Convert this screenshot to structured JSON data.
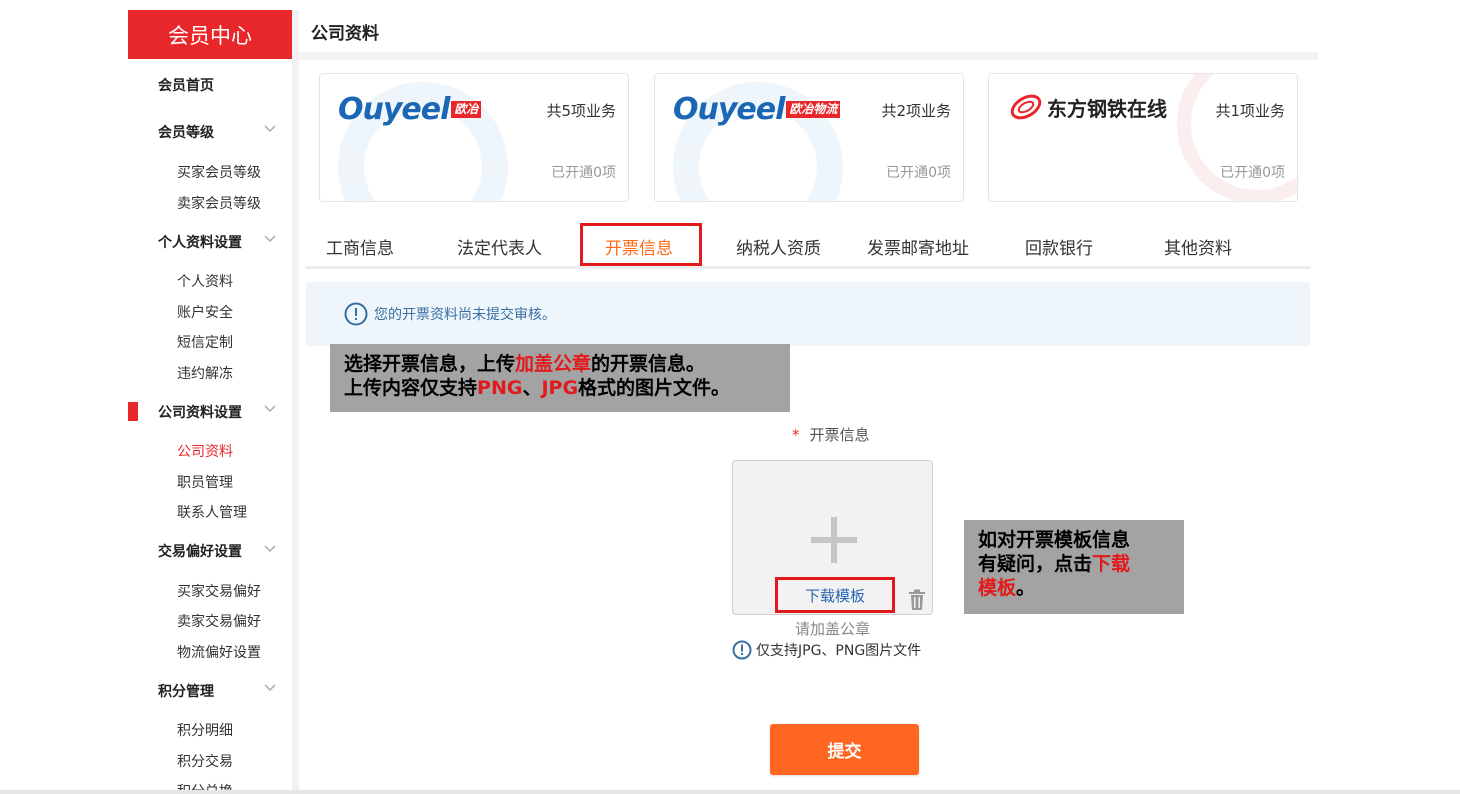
{
  "sidebar": {
    "header": "会员中心",
    "home": "会员首页",
    "groups": [
      {
        "label": "会员等级",
        "items": [
          "买家会员等级",
          "卖家会员等级"
        ]
      },
      {
        "label": "个人资料设置",
        "items": [
          "个人资料",
          "账户安全",
          "短信定制",
          "违约解冻"
        ]
      },
      {
        "label": "公司资料设置",
        "items": [
          "公司资料",
          "职员管理",
          "联系人管理"
        ]
      },
      {
        "label": "交易偏好设置",
        "items": [
          "买家交易偏好",
          "卖家交易偏好",
          "物流偏好设置"
        ]
      },
      {
        "label": "积分管理",
        "items": [
          "积分明细",
          "积分交易",
          "积分兑换"
        ]
      }
    ],
    "active_item": "公司资料"
  },
  "main": {
    "title": "公司资料",
    "cards": [
      {
        "logo_text": "Ouyeel",
        "logo_tag": "欧冶",
        "count": "共5项业务",
        "opened": "已开通0项"
      },
      {
        "logo_text": "Ouyeel",
        "logo_tag": "欧冶物流",
        "count": "共2项业务",
        "opened": "已开通0项"
      },
      {
        "logo_text": "东方钢铁在线",
        "logo_tag": "",
        "count": "共1项业务",
        "opened": "已开通0项"
      }
    ],
    "tabs": [
      "工商信息",
      "法定代表人",
      "开票信息",
      "纳税人资质",
      "发票邮寄地址",
      "回款银行",
      "其他资料"
    ],
    "active_tab": "开票信息",
    "notice": "您的开票资料尚未提交审核。",
    "upload": {
      "label": "开票信息",
      "required_mark": "*",
      "download_link": "下载模板",
      "stamp_hint": "请加盖公章",
      "format_hint": "仅支持JPG、PNG图片文件"
    },
    "submit_label": "提交"
  },
  "annotations": {
    "callout1_line1_a": "选择开票信息，上传",
    "callout1_line1_red": "加盖公章",
    "callout1_line1_b": "的开票信息。",
    "callout1_line2_a": "上传内容仅支持",
    "callout1_line2_red1": "PNG",
    "callout1_line2_sep": "、",
    "callout1_line2_red2": "JPG",
    "callout1_line2_b": "格式的图片文件。",
    "callout2_line1": "如对开票模板信息",
    "callout2_line2_a": "有疑问，点击",
    "callout2_line2_red": "下载",
    "callout2_line3_red": "模板",
    "callout2_line3_b": "。"
  },
  "colors": {
    "brand_red": "#e8272b",
    "accent_orange": "#ff6a1a",
    "submit_orange": "#ff6622",
    "link_blue": "#2a66b5",
    "ouyeel_blue": "#1b67b3",
    "annotation_red": "#e31a1c",
    "callout_gray": "#a3a3a3"
  }
}
